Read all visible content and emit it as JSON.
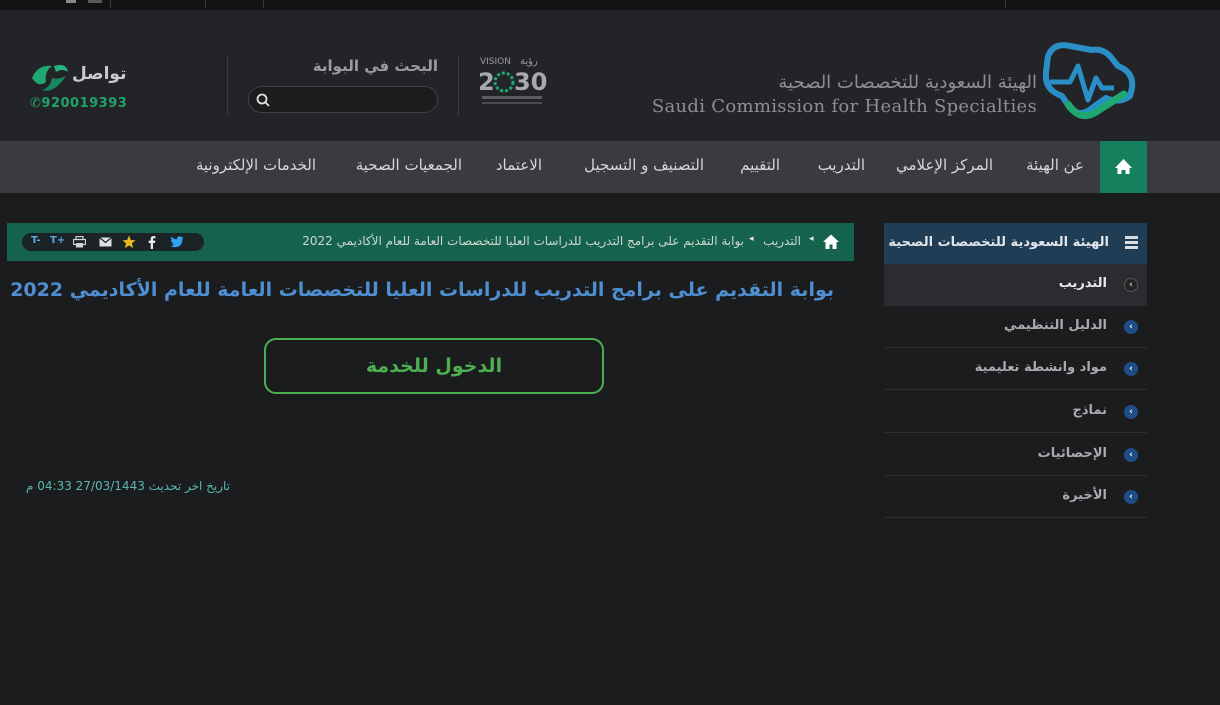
{
  "colors": {
    "accent_green": "#14805e",
    "title_blue": "#4f8ed0",
    "button_green": "#4caf50",
    "side_header_blue": "#1f3d55"
  },
  "header": {
    "org_name_ar": "الهيئة السعودية للتخصصات الصحية",
    "org_name_en": "Saudi Commission for Health Specialties",
    "search_title": "البحث في البوابة",
    "search_placeholder": "",
    "contact_label": "تواصل",
    "contact_phone": "920019393",
    "vision_icon": "vision-2030-icon",
    "logo_icon": "schs-logo-icon"
  },
  "nav": {
    "home_icon": "home-icon",
    "items": [
      "عن الهيئة",
      "المركز الإعلامي",
      "التدريب",
      "التقييم",
      "التصنيف و التسجيل",
      "الاعتماد",
      "الجمعيات الصحية",
      "الخدمات الإلكترونية"
    ]
  },
  "breadcrumb": {
    "items": [
      "التدريب",
      "بوابة التقديم على برامج التدريب للدراسات العليا للتخصصات العامة للعام الأكاديمي 2022"
    ],
    "tools": [
      "T-",
      "T+"
    ]
  },
  "main": {
    "title": "بوابة التقديم على برامج التدريب للدراسات العليا للتخصصات العامة للعام الأكاديمي 2022",
    "service_button": "الدخول للخدمة",
    "last_updated": "تاريخ اخر تحديث 27/03/1443 04:33 م"
  },
  "sidebar": {
    "header": "الهيئة السعودية للتخصصات الصحية",
    "items": [
      "التدريب",
      "الدليل التنظيمي",
      "مواد وانشطة تعليمية",
      "نماذج",
      "الإحصائيات",
      "الأخيرة"
    ]
  }
}
